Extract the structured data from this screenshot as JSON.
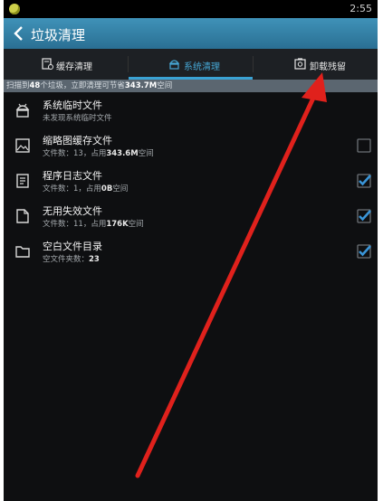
{
  "status": {
    "time": "2:55"
  },
  "titlebar": {
    "title": "垃圾清理"
  },
  "tabs": [
    {
      "label": "缓存清理",
      "active": false
    },
    {
      "label": "系统清理",
      "active": true
    },
    {
      "label": "卸载残留",
      "active": false
    }
  ],
  "info": {
    "prefix": "扫描到",
    "count": "48",
    "middle": "个垃圾，立即清理可节省",
    "size": "343.7M",
    "suffix": "空间"
  },
  "items": [
    {
      "title": "系统临时文件",
      "subtitle": "未发现系统临时文件",
      "checked": null,
      "icon": "android-icon"
    },
    {
      "title": "缩略图缓存文件",
      "subtitle_prefix": "文件数：13，占用",
      "subtitle_value": "343.6M",
      "subtitle_suffix": "空间",
      "checked": false,
      "icon": "image-icon"
    },
    {
      "title": "程序日志文件",
      "subtitle_prefix": "文件数：1，占用",
      "subtitle_value": "0B",
      "subtitle_suffix": "空间",
      "checked": true,
      "icon": "log-file-icon"
    },
    {
      "title": "无用失效文件",
      "subtitle_prefix": "文件数：11，占用",
      "subtitle_value": "176K",
      "subtitle_suffix": "空间",
      "checked": true,
      "icon": "file-icon"
    },
    {
      "title": "空白文件目录",
      "subtitle_prefix": "空文件夹数：",
      "subtitle_value": "23",
      "subtitle_suffix": "",
      "checked": true,
      "icon": "folder-icon"
    }
  ],
  "colors": {
    "accent": "#3aa2d4",
    "check": "#3a95d8",
    "arrow": "#e0211c"
  }
}
